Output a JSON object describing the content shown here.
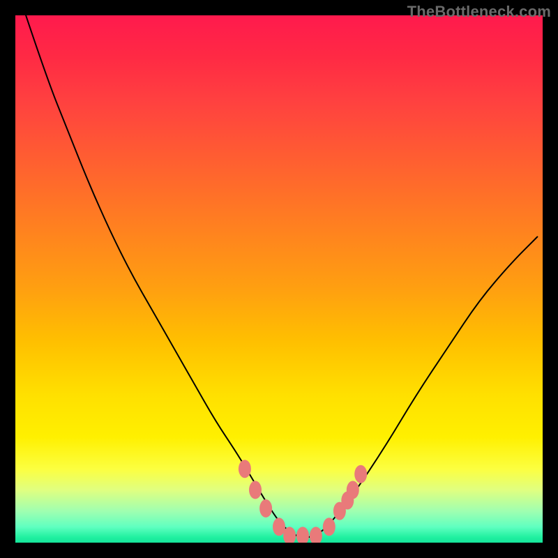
{
  "watermark": "TheBottleneck.com",
  "chart_data": {
    "type": "line",
    "title": "",
    "xlabel": "",
    "ylabel": "",
    "xlim": [
      0,
      100
    ],
    "ylim": [
      0,
      100
    ],
    "series": [
      {
        "name": "curve",
        "x": [
          2,
          6,
          10,
          14,
          18,
          22,
          26,
          30,
          34,
          38,
          42,
          45,
          48,
          50,
          52,
          54,
          56,
          58,
          60,
          64,
          70,
          76,
          82,
          88,
          94,
          99
        ],
        "values": [
          100,
          88,
          78,
          68,
          59,
          51,
          44,
          37,
          30,
          23,
          17,
          12,
          7,
          4,
          2,
          1,
          1,
          2,
          4,
          9,
          18,
          28,
          37,
          46,
          53,
          58
        ]
      }
    ],
    "markers": {
      "name": "highlight-dots",
      "color": "#e97a7a",
      "points": [
        {
          "x": 43.5,
          "y": 14
        },
        {
          "x": 45.5,
          "y": 10
        },
        {
          "x": 47.5,
          "y": 6.5
        },
        {
          "x": 50,
          "y": 3
        },
        {
          "x": 52,
          "y": 1.3
        },
        {
          "x": 54.5,
          "y": 1.3
        },
        {
          "x": 57,
          "y": 1.3
        },
        {
          "x": 59.5,
          "y": 3
        },
        {
          "x": 61.5,
          "y": 6
        },
        {
          "x": 63,
          "y": 8
        },
        {
          "x": 64,
          "y": 10
        },
        {
          "x": 65.5,
          "y": 13
        }
      ]
    }
  }
}
